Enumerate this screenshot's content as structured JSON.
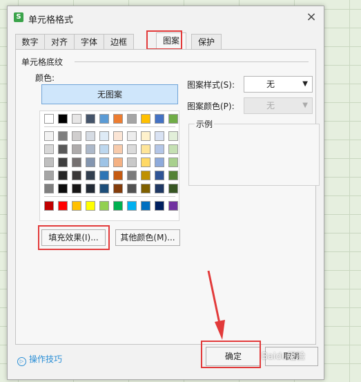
{
  "dialog": {
    "title": "单元格格式",
    "app_icon": "S",
    "close_glyph": "×"
  },
  "tabs": [
    {
      "label": "数字"
    },
    {
      "label": "对齐"
    },
    {
      "label": "字体"
    },
    {
      "label": "边框"
    },
    {
      "label": "图案",
      "active": true
    },
    {
      "label": "保护"
    }
  ],
  "shading": {
    "section_title": "单元格底纹",
    "color_label": "颜色:",
    "no_pattern": "无图案",
    "fill_effects": "填充效果(I)...",
    "more_colors": "其他颜色(M)..."
  },
  "pattern": {
    "style_label": "图案样式(S):",
    "style_value": "无",
    "color_label": "图案颜色(P):",
    "color_value": "无",
    "example_label": "示例"
  },
  "footer": {
    "tips_label": "操作技巧",
    "tips_icon": "▷",
    "ok_label": "确定",
    "cancel_label": "取消"
  },
  "watermark": "Baidu经验",
  "colors": {
    "highlight_red": "#e23a3a",
    "accent_blue": "#cfe6fb"
  },
  "palette": {
    "top_row": [
      "#ffffff",
      "#000000",
      "#e7e6e6",
      "#44546a",
      "#5b9bd5",
      "#ed7d31",
      "#a5a5a5",
      "#ffc000",
      "#4472c4",
      "#70ad47"
    ],
    "shades": [
      [
        "#f2f2f2",
        "#7f7f7f",
        "#d0cece",
        "#d6dce4",
        "#deebf6",
        "#fbe5d5",
        "#ededed",
        "#fff2cc",
        "#d9e2f3",
        "#e2efd9"
      ],
      [
        "#d8d8d8",
        "#595959",
        "#aeabab",
        "#adb9ca",
        "#bdd7ee",
        "#f7cbac",
        "#dbdbdb",
        "#fee599",
        "#b4c6e7",
        "#c5e0b3"
      ],
      [
        "#bfbfbf",
        "#3f3f3f",
        "#757070",
        "#8496b0",
        "#9dc3e6",
        "#f4b183",
        "#c9c9c9",
        "#ffd965",
        "#8eaadb",
        "#a8d08d"
      ],
      [
        "#a5a5a5",
        "#262626",
        "#3a3838",
        "#323f4f",
        "#2e75b5",
        "#c55a11",
        "#7b7b7b",
        "#bf9000",
        "#2f5496",
        "#538135"
      ],
      [
        "#7f7f7f",
        "#0c0c0c",
        "#171616",
        "#222a35",
        "#1e4e79",
        "#833c0b",
        "#525252",
        "#7f6000",
        "#1f3864",
        "#375623"
      ]
    ],
    "standard": [
      "#c00000",
      "#ff0000",
      "#ffc000",
      "#ffff00",
      "#92d050",
      "#00b050",
      "#00b0f0",
      "#0070c0",
      "#002060",
      "#7030a0"
    ]
  }
}
